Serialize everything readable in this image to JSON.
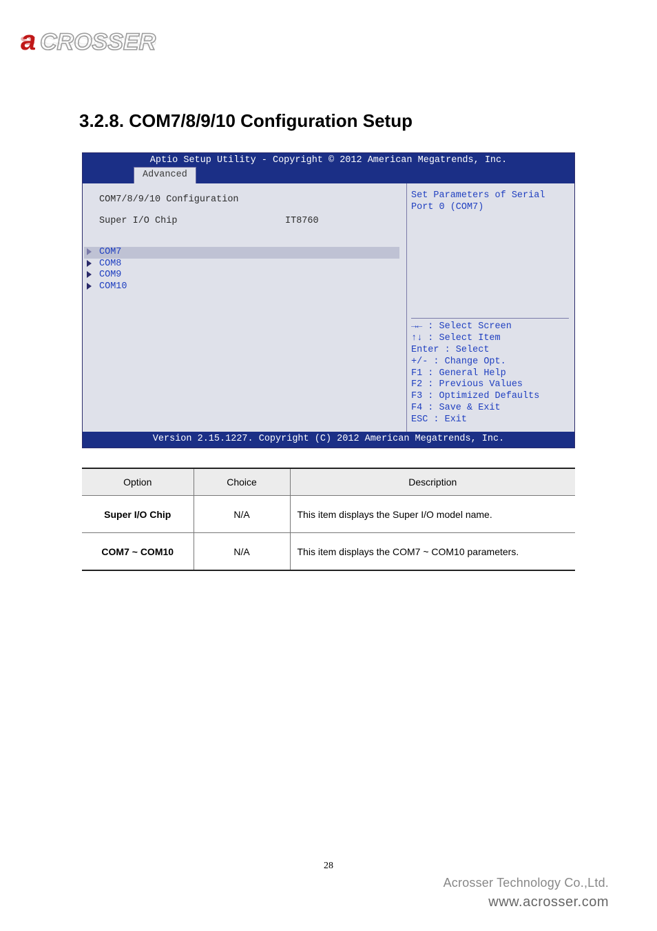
{
  "logo": {
    "brand": "aCROSSER"
  },
  "heading": "3.2.8. COM7/8/9/10 Configuration Setup",
  "bios": {
    "title": "Aptio Setup Utility - Copyright © 2012 American Megatrends, Inc.",
    "tab": "Advanced",
    "cfg_title": "COM7/8/9/10 Configuration",
    "super_io_label": "Super I/O Chip",
    "super_io_value": "IT8760",
    "coms": [
      "COM7",
      "COM8",
      "COM9",
      "COM10"
    ],
    "help": "Set Parameters of Serial Port 0 (COM7)",
    "nav": [
      "→← : Select Screen",
      "↑↓ : Select Item",
      "Enter : Select",
      "+/- : Change Opt.",
      "F1 : General Help",
      "F2 : Previous Values",
      "F3 : Optimized Defaults",
      "F4 : Save & Exit",
      "ESC : Exit"
    ],
    "version": "Version 2.15.1227. Copyright (C) 2012 American Megatrends, Inc."
  },
  "table": {
    "headers": {
      "option": "Option",
      "choice": "Choice",
      "description": "Description"
    },
    "rows": [
      {
        "option": "Super I/O Chip",
        "choice": "N/A",
        "description": "This item displays the Super I/O model name."
      },
      {
        "option": "COM7 ~ COM10",
        "choice": "N/A",
        "description": "This item displays the COM7 ~ COM10 parameters."
      }
    ]
  },
  "page_number": "28",
  "footer": {
    "company": "Acrosser Technology Co.,Ltd.",
    "url": "www.acrosser.com"
  }
}
